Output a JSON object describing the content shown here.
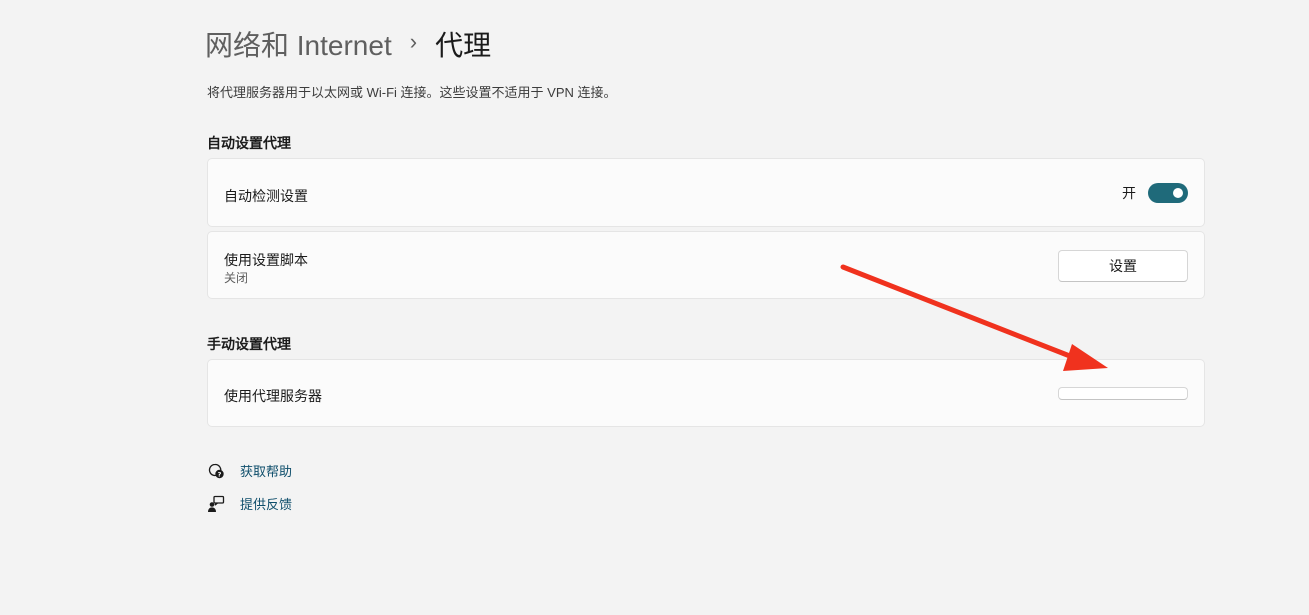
{
  "header": {
    "parent": "网络和 Internet",
    "separator": "›",
    "current": "代理"
  },
  "description": "将代理服务器用于以太网或 Wi-Fi 连接。这些设置不适用于 VPN 连接。",
  "auto_section": {
    "title": "自动设置代理",
    "detect": {
      "label": "自动检测设置",
      "state_text": "开",
      "enabled": true
    },
    "script": {
      "label": "使用设置脚本",
      "sub": "关闭",
      "button_label": "设置"
    }
  },
  "manual_section": {
    "title": "手动设置代理",
    "proxy": {
      "label": "使用代理服务器",
      "button_label": ""
    }
  },
  "links": {
    "help": "获取帮助",
    "feedback": "提供反馈"
  },
  "annotation": {
    "arrow_color": "#f0321e"
  },
  "icons": {
    "help": "help-chat-icon",
    "feedback": "feedback-person-icon"
  }
}
